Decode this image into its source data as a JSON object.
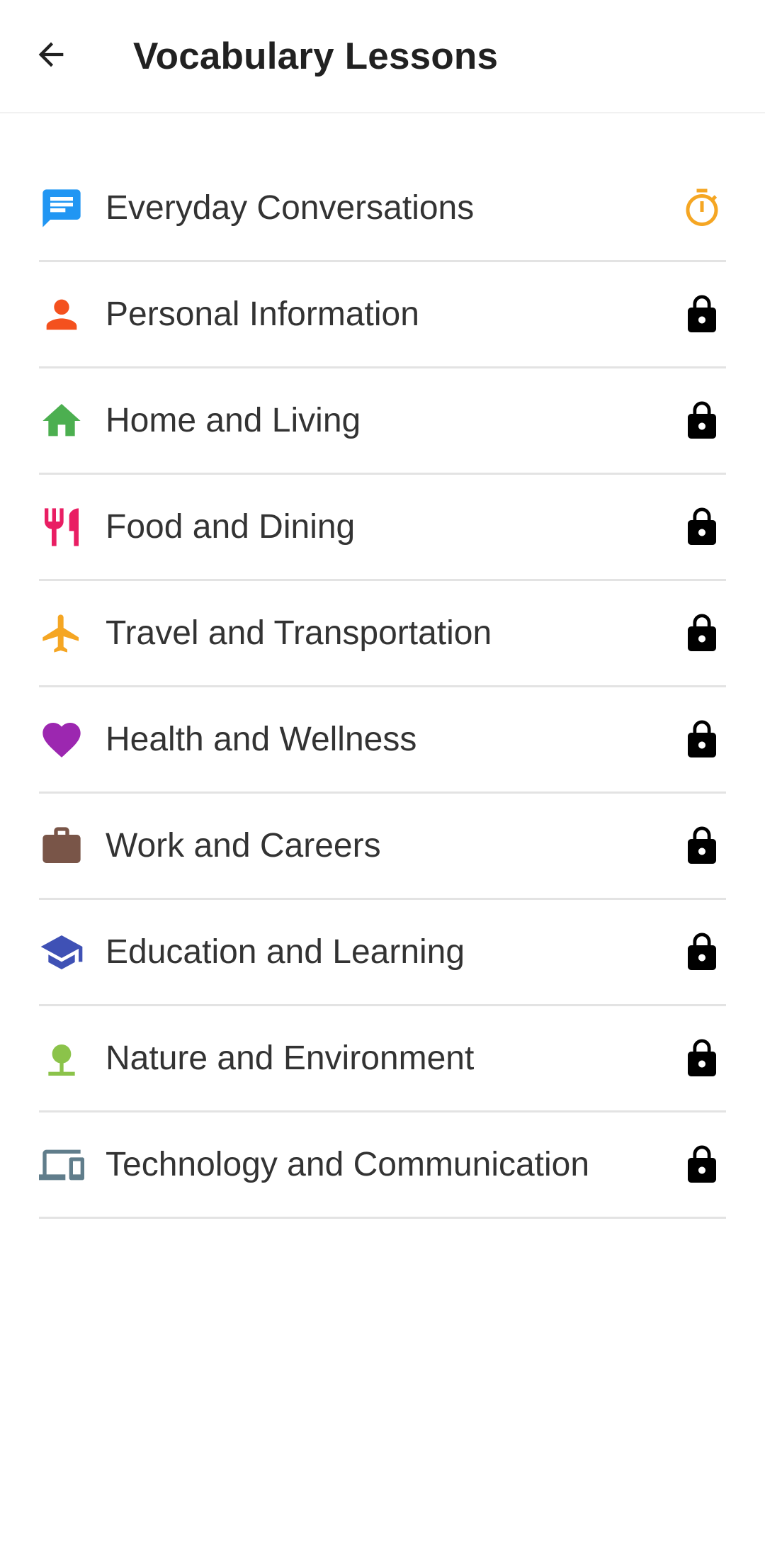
{
  "header": {
    "title": "Vocabulary Lessons",
    "back_icon": "arrow-back-icon"
  },
  "colors": {
    "timer": "#F5A623",
    "lock": "#000000",
    "divider": "#E3E3E3"
  },
  "lessons": [
    {
      "label": "Everyday Conversations",
      "icon": "chat-icon",
      "icon_color": "#2196F3",
      "status": "in-progress",
      "status_icon": "timer-icon"
    },
    {
      "label": "Personal Information",
      "icon": "person-icon",
      "icon_color": "#F4511E",
      "status": "locked",
      "status_icon": "lock-icon"
    },
    {
      "label": "Home and Living",
      "icon": "home-icon",
      "icon_color": "#4CAF50",
      "status": "locked",
      "status_icon": "lock-icon"
    },
    {
      "label": "Food and Dining",
      "icon": "restaurant-icon",
      "icon_color": "#E91E63",
      "status": "locked",
      "status_icon": "lock-icon"
    },
    {
      "label": "Travel and Transportation",
      "icon": "airplane-icon",
      "icon_color": "#F5A623",
      "status": "locked",
      "status_icon": "lock-icon"
    },
    {
      "label": "Health and Wellness",
      "icon": "heart-icon",
      "icon_color": "#9C27B0",
      "status": "locked",
      "status_icon": "lock-icon"
    },
    {
      "label": "Work and Careers",
      "icon": "briefcase-icon",
      "icon_color": "#795548",
      "status": "locked",
      "status_icon": "lock-icon"
    },
    {
      "label": "Education and Learning",
      "icon": "school-icon",
      "icon_color": "#3F51B5",
      "status": "locked",
      "status_icon": "lock-icon"
    },
    {
      "label": "Nature and Environment",
      "icon": "tree-icon",
      "icon_color": "#8BC34A",
      "status": "locked",
      "status_icon": "lock-icon"
    },
    {
      "label": "Technology and Communication",
      "icon": "devices-icon",
      "icon_color": "#607D8B",
      "status": "locked",
      "status_icon": "lock-icon"
    }
  ]
}
